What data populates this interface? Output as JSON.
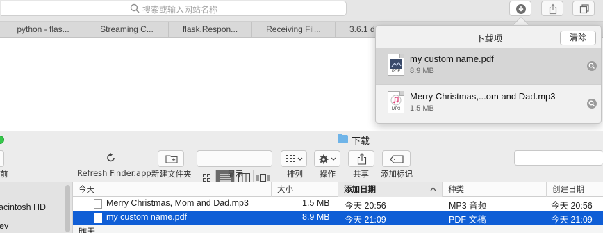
{
  "safari": {
    "address_placeholder": "搜索或输入网站名称",
    "tabs": [
      {
        "label": "python - flas..."
      },
      {
        "label": "Streaming C..."
      },
      {
        "label": "flask.Respon..."
      },
      {
        "label": "Receiving Fil..."
      },
      {
        "label": "3.6.1 do"
      }
    ]
  },
  "downloads": {
    "title": "下载项",
    "clear_label": "清除",
    "items": [
      {
        "name": "my custom name.pdf",
        "size": "8.9 MB",
        "type_label": "PDF",
        "selected": true
      },
      {
        "name": "Merry Christmas,...om and Dad.mp3",
        "size": "1.5 MB",
        "type_label": "MP3",
        "selected": false
      }
    ]
  },
  "finder": {
    "title": "下载",
    "toolbar": {
      "back_label": "前",
      "refresh_label": "Refresh Finder.app",
      "new_folder_label": "新建文件夹",
      "view_label": "显示",
      "arrange_label": "排列",
      "action_label": "操作",
      "share_label": "共享",
      "tags_label": "添加标记"
    },
    "sidebar": {
      "items": [
        {
          "label": "acintosh HD"
        },
        {
          "label": "ev"
        }
      ]
    },
    "columns": {
      "name": "今天",
      "size": "大小",
      "date_added": "添加日期",
      "kind": "种类",
      "created": "创建日期"
    },
    "rows": [
      {
        "name": "Merry Christmas, Mom and Dad.mp3",
        "size": "1.5 MB",
        "date_added": "今天 20:56",
        "kind": "MP3 音频",
        "created": "今天 20:56",
        "selected": false
      },
      {
        "name": "my custom name.pdf",
        "size": "8.9 MB",
        "date_added": "今天 21:09",
        "kind": "PDF 文稿",
        "created": "今天 21:09",
        "selected": true
      }
    ],
    "next_group_label": "昨天"
  },
  "colors": {
    "selection_blue": "#0f5ed6",
    "traffic_green": "#34c84a",
    "folder_blue": "#6fb4e8"
  }
}
